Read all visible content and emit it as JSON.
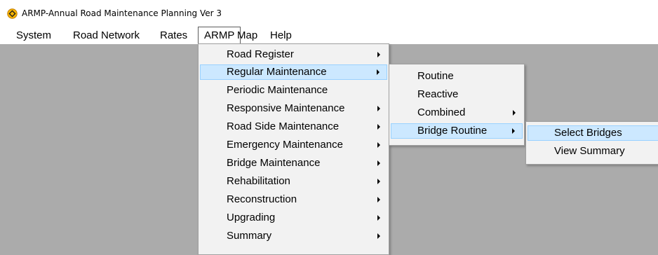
{
  "window": {
    "title": "ARMP-Annual Road Maintenance Planning Ver 3",
    "icon": "road-sign-icon"
  },
  "menubar": {
    "items": [
      "System",
      "Road Network",
      "Rates",
      "ARMP",
      "Map",
      "Help"
    ],
    "open_item": "ARMP"
  },
  "armp_menu": {
    "items": [
      "Road Register",
      "Regular Maintenance",
      "Periodic Maintenance",
      "Responsive Maintenance",
      "Road Side Maintenance",
      "Emergency Maintenance",
      "Bridge Maintenance",
      "Rehabilitation",
      "Reconstruction",
      "Upgrading",
      "Summary"
    ],
    "highlighted": "Regular Maintenance"
  },
  "regular_maintenance_menu": {
    "items": [
      "Routine",
      "Reactive",
      "Combined",
      "Bridge Routine"
    ],
    "highlighted": "Bridge Routine"
  },
  "bridge_routine_menu": {
    "items": [
      "Select Bridges",
      "View Summary"
    ],
    "highlighted": "Select Bridges"
  },
  "colors": {
    "highlight_fill": "#cce8ff",
    "highlight_border": "#99d1ff",
    "workspace": "#ababab"
  }
}
